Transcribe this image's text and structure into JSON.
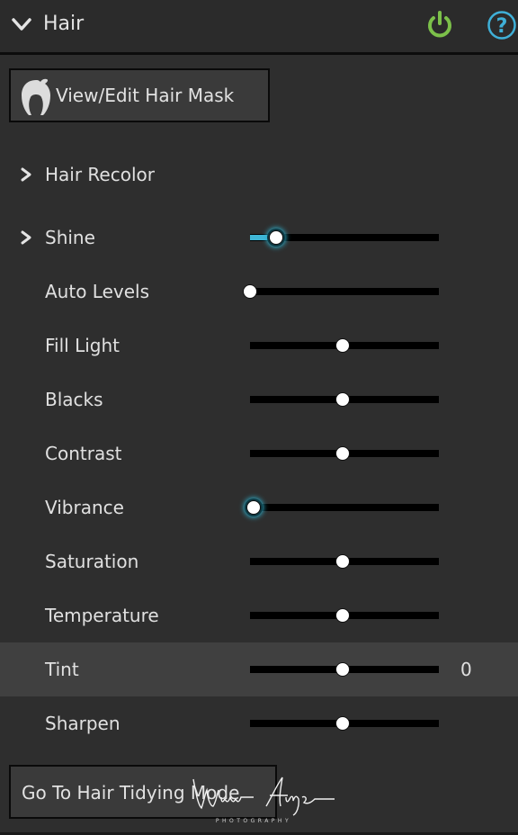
{
  "header": {
    "title": "Hair",
    "collapse_icon": "chevron-down-icon",
    "power_icon": "power-icon",
    "help_icon": "help-icon",
    "power_color": "#7cc04a",
    "help_color": "#3fb0d8"
  },
  "mask_button": {
    "label": "View/Edit Hair Mask",
    "icon": "hair-icon"
  },
  "sections": [
    {
      "label": "Hair Recolor",
      "expandable": true
    }
  ],
  "sliders": [
    {
      "label": "Shine",
      "expandable": true,
      "value_fraction": 0.14,
      "active": true,
      "show_value": false
    },
    {
      "label": "Auto Levels",
      "value_fraction": 0.0,
      "active": false
    },
    {
      "label": "Fill Light",
      "value_fraction": 0.49,
      "active": false
    },
    {
      "label": "Blacks",
      "value_fraction": 0.49,
      "active": false
    },
    {
      "label": "Contrast",
      "value_fraction": 0.49,
      "active": false
    },
    {
      "label": "Vibrance",
      "value_fraction": 0.02,
      "active": true
    },
    {
      "label": "Saturation",
      "value_fraction": 0.49,
      "active": false
    },
    {
      "label": "Temperature",
      "value_fraction": 0.49,
      "active": false
    },
    {
      "label": "Tint",
      "value_fraction": 0.49,
      "active": false,
      "highlighted": true,
      "value_text": "0"
    },
    {
      "label": "Sharpen",
      "value_fraction": 0.49,
      "active": false
    }
  ],
  "tidy_button": {
    "label": "Go To Hair Tidying Mode"
  },
  "watermark": {
    "signature": "Wim Arys",
    "subtitle": "PHOTOGRAPHY"
  },
  "colors": {
    "accent": "#3fb6d6",
    "panel": "#2e2e2e",
    "highlight_row": "#404040"
  }
}
